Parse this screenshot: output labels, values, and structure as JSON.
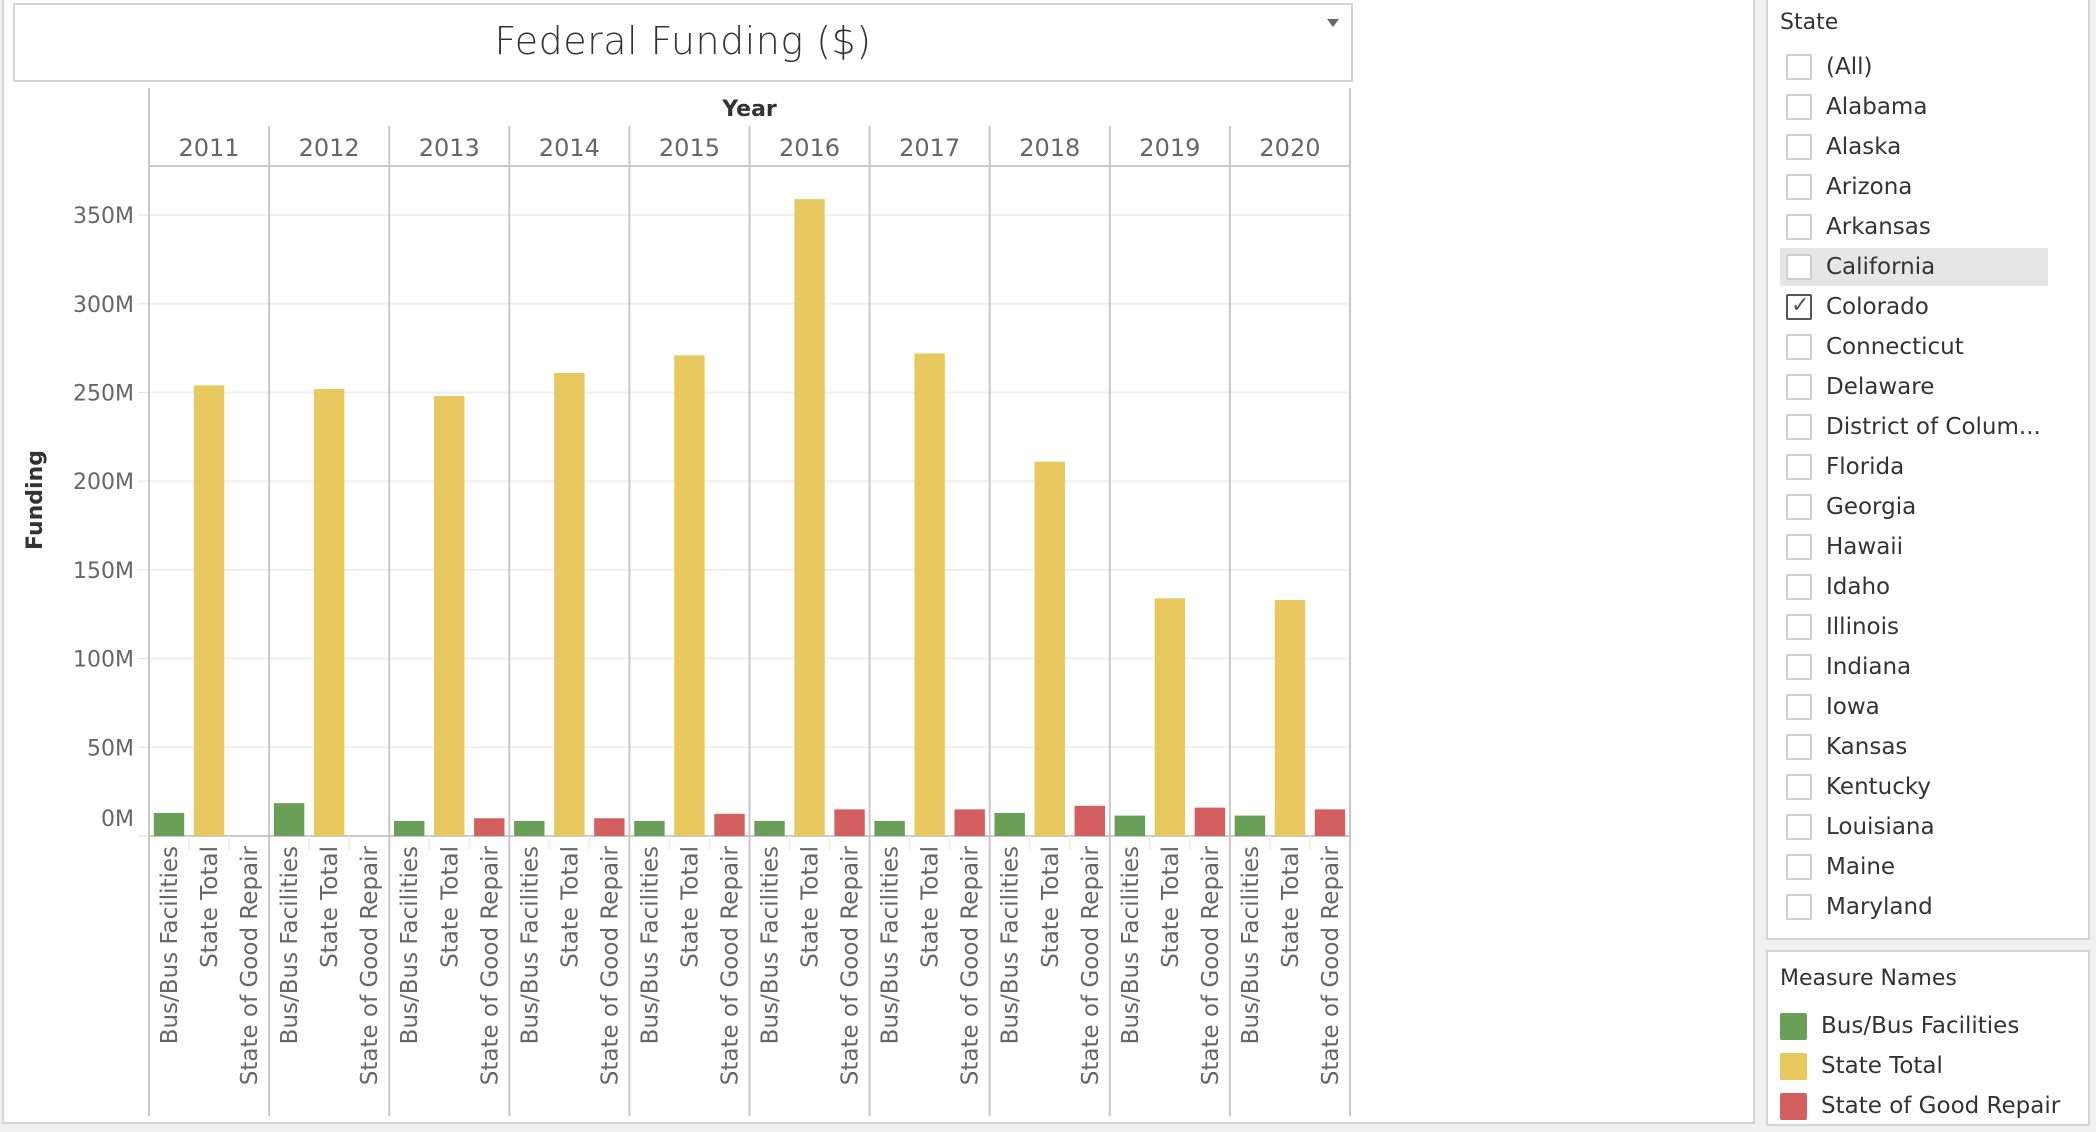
{
  "dashboard": {
    "title": "Federal Funding ($)",
    "title_menu_icon": "dropdown-arrow-icon"
  },
  "chart_data": {
    "type": "bar",
    "title": "Federal Funding ($)",
    "column_header_title": "Year",
    "xlabel": "",
    "ylabel": "Funding",
    "ylim": [
      0,
      375000000
    ],
    "y_ticks": [
      0,
      50000000,
      100000000,
      150000000,
      200000000,
      250000000,
      300000000,
      350000000
    ],
    "y_tick_labels": [
      "0M",
      "50M",
      "100M",
      "150M",
      "200M",
      "250M",
      "300M",
      "350M"
    ],
    "grid": true,
    "years": [
      "2011",
      "2012",
      "2013",
      "2014",
      "2015",
      "2016",
      "2017",
      "2018",
      "2019",
      "2020"
    ],
    "categories": [
      "Bus/Bus Facilities",
      "State Total",
      "State of Good Repair"
    ],
    "series": [
      {
        "name": "Bus/Bus Facilities",
        "color": "#6a9f58",
        "values": [
          13000000,
          18500000,
          8500000,
          8500000,
          8500000,
          8500000,
          8500000,
          13000000,
          11500000,
          11500000
        ]
      },
      {
        "name": "State Total",
        "color": "#e7c95f",
        "values": [
          254000000,
          252000000,
          248000000,
          261000000,
          271000000,
          359000000,
          272000000,
          211000000,
          134000000,
          133000000
        ]
      },
      {
        "name": "State of Good Repair",
        "color": "#d45f5f",
        "values": [
          0,
          0,
          10000000,
          10000000,
          12500000,
          15000000,
          15000000,
          17000000,
          16000000,
          15000000
        ]
      }
    ],
    "legend": {
      "title": "Measure Names",
      "position": "right"
    }
  },
  "filter": {
    "title": "State",
    "items": [
      {
        "label": "(All)",
        "checked": false
      },
      {
        "label": "Alabama",
        "checked": false
      },
      {
        "label": "Alaska",
        "checked": false
      },
      {
        "label": "Arizona",
        "checked": false
      },
      {
        "label": "Arkansas",
        "checked": false
      },
      {
        "label": "California",
        "checked": false,
        "hover": true
      },
      {
        "label": "Colorado",
        "checked": true
      },
      {
        "label": "Connecticut",
        "checked": false
      },
      {
        "label": "Delaware",
        "checked": false
      },
      {
        "label": "District of Colum...",
        "checked": false
      },
      {
        "label": "Florida",
        "checked": false
      },
      {
        "label": "Georgia",
        "checked": false
      },
      {
        "label": "Hawaii",
        "checked": false
      },
      {
        "label": "Idaho",
        "checked": false
      },
      {
        "label": "Illinois",
        "checked": false
      },
      {
        "label": "Indiana",
        "checked": false
      },
      {
        "label": "Iowa",
        "checked": false
      },
      {
        "label": "Kansas",
        "checked": false
      },
      {
        "label": "Kentucky",
        "checked": false
      },
      {
        "label": "Louisiana",
        "checked": false
      },
      {
        "label": "Maine",
        "checked": false
      },
      {
        "label": "Maryland",
        "checked": false
      }
    ]
  },
  "legend": {
    "title": "Measure Names",
    "items": [
      {
        "label": "Bus/Bus Facilities",
        "color": "#6a9f58"
      },
      {
        "label": "State Total",
        "color": "#e7c95f"
      },
      {
        "label": "State of Good Repair",
        "color": "#d45f5f"
      }
    ]
  }
}
